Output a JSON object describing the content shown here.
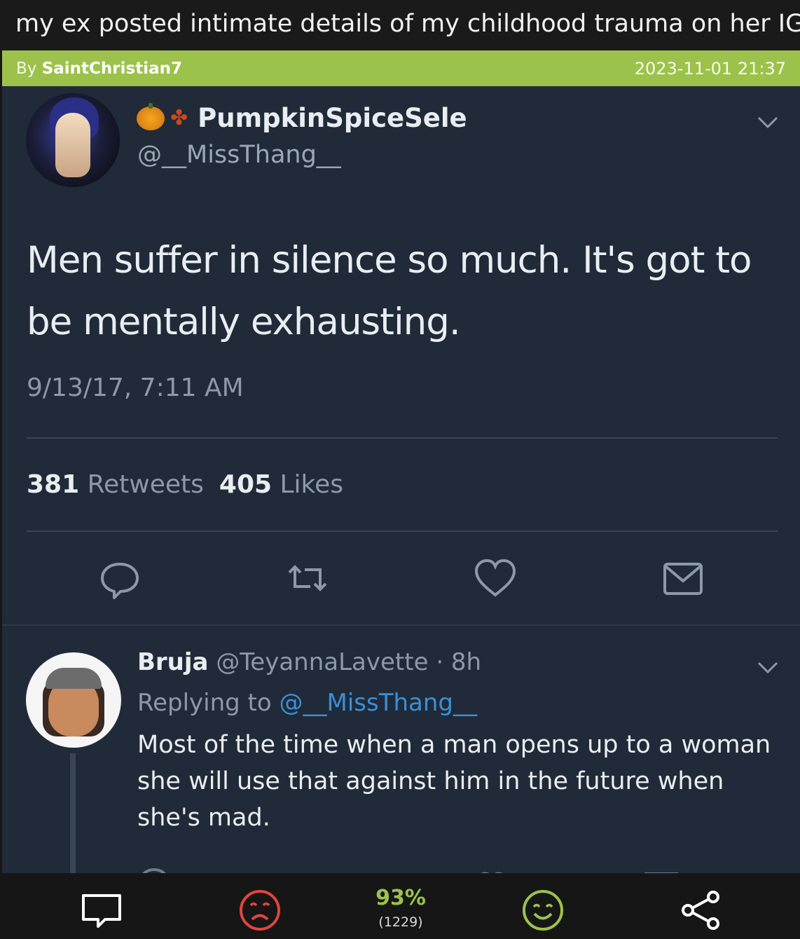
{
  "post": {
    "title": "my ex posted intimate details of my childhood trauma on her IG story",
    "by_label": "By",
    "author": "SaintChristian7",
    "date": "2023-11-01 21:37"
  },
  "tweet": {
    "display_name": "PumpkinSpiceSele",
    "handle": "@__MissThang__",
    "text": "Men suffer in silence so much. It's got to be mentally exhausting.",
    "time": "9/13/17, 7:11 AM",
    "retweets_count": "381",
    "retweets_label": "Retweets",
    "likes_count": "405",
    "likes_label": "Likes"
  },
  "reply": {
    "name": "Bruja",
    "handle_time": "@TeyannaLavette · 8h",
    "replying_label": "Replying to",
    "replying_to": "@__MissThang__",
    "text": "Most of the time when a man opens up to a woman she will use that against him in the future when she's mad."
  },
  "footer": {
    "score_percent": "93%",
    "vote_count": "(1229)"
  },
  "colors": {
    "accent_green": "#9cc24b",
    "downvote_red": "#e0463d",
    "tweet_bg": "#212a38",
    "link_blue": "#3a90d8"
  },
  "icons": {
    "tweet_pumpkin": "pumpkin-icon",
    "tweet_leaf": "maple-leaf-icon",
    "tweet_chevron": "chevron-down-icon",
    "tweet_actions": [
      "reply-icon",
      "retweet-icon",
      "heart-icon",
      "mail-icon"
    ],
    "footer": [
      "comment-icon",
      "frown-icon",
      "smile-icon",
      "share-icon"
    ]
  }
}
